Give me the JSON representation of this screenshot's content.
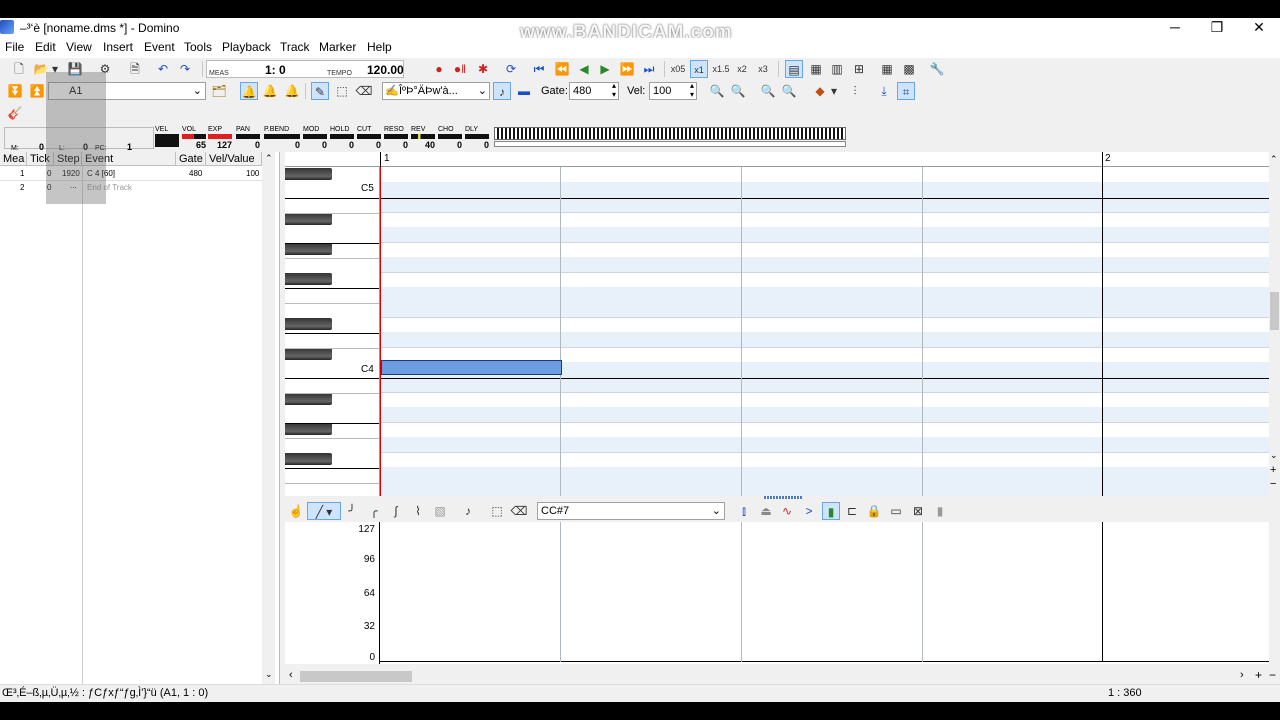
{
  "window": {
    "title": "–³‘è [noname.dms *] - Domino",
    "watermark": "www.BANDICAM.com",
    "minimize": "─",
    "restore": "❐",
    "close": "✕"
  },
  "menu": [
    "File",
    "Edit",
    "View",
    "Insert",
    "Event",
    "Tools",
    "Playback",
    "Track",
    "Marker",
    "Help"
  ],
  "transport": {
    "meas_label": "MEAS",
    "meas_value": "1:  0",
    "tempo_label": "TEMPO",
    "tempo_value": "120.00",
    "zoom_options": [
      "x05",
      "x1",
      "x1.5",
      "x2",
      "x3"
    ]
  },
  "track_bar": {
    "track_select": "A1",
    "mode_select": "ÎºÞ°ÄÞw'à...",
    "gate_label": "Gate:",
    "gate_value": "480",
    "vel_label": "Vel:",
    "vel_value": "100"
  },
  "mixer": {
    "m_label": "M:",
    "m_value": "0",
    "l_label": "L:",
    "l_value": "0",
    "pc_label": "PC:",
    "pc_value": "1",
    "controls": [
      {
        "name": "VEL",
        "value": ""
      },
      {
        "name": "VOL",
        "value": "65"
      },
      {
        "name": "EXP",
        "value": "127"
      },
      {
        "name": "PAN",
        "value": "0"
      },
      {
        "name": "P.BEND",
        "value": "0"
      },
      {
        "name": "MOD",
        "value": "0"
      },
      {
        "name": "HOLD",
        "value": "0"
      },
      {
        "name": "CUT",
        "value": "0"
      },
      {
        "name": "RESO",
        "value": "0"
      },
      {
        "name": "REV",
        "value": "40"
      },
      {
        "name": "CHO",
        "value": "0"
      },
      {
        "name": "DLY",
        "value": "0"
      }
    ],
    "colors": {
      "vol": "#e02020",
      "exp": "#e02020"
    }
  },
  "event_list": {
    "headers": [
      "Mea",
      "Tick",
      "Step",
      "Event",
      "Gate",
      "Vel/Value"
    ],
    "rows": [
      {
        "mea": "1",
        "tick": "0",
        "step": "1920",
        "event": "C  4 [60]",
        "gate": "480",
        "vel": "100"
      },
      {
        "mea": "2",
        "tick": "0",
        "step": "...",
        "event": "End of Track",
        "gate": "",
        "vel": ""
      }
    ]
  },
  "piano_roll": {
    "ruler_labels": [
      "1",
      "2"
    ],
    "key_labels": [
      "C5",
      "C4"
    ],
    "note": {
      "pitch": "C4",
      "start_beat": 0,
      "length_beats": 1
    }
  },
  "controller": {
    "cc_select": "CC#7",
    "scale": [
      "127",
      "96",
      "64",
      "32",
      "0"
    ]
  },
  "status": {
    "left": "Œ³‚É–ß‚µ‚Ü‚µ‚½ : ƒCƒxƒ“ƒg‚Ì'}“ü (A1, 1 : 0)",
    "right": "1 : 360"
  },
  "colors": {
    "grid_blue": "#e8f0fa",
    "note": "#6b9de0",
    "cursor": "#dd0000"
  }
}
